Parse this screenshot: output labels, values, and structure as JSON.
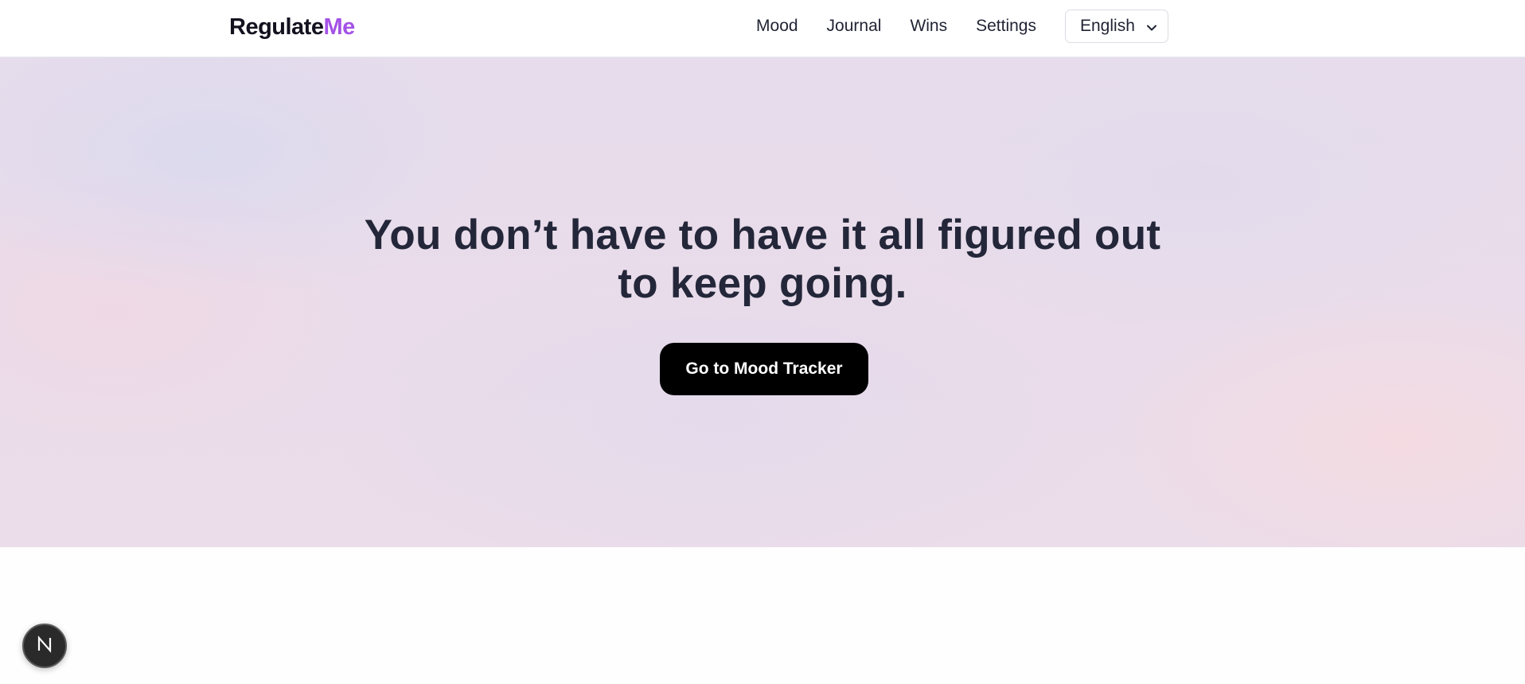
{
  "brand": {
    "name_main": "Regulate",
    "name_accent": "Me",
    "accent_color": "#a452e6"
  },
  "nav": {
    "links": [
      "Mood",
      "Journal",
      "Wins",
      "Settings"
    ],
    "language": {
      "selected": "English",
      "icon": "chevron-down-icon"
    }
  },
  "hero": {
    "headline_line1": "You don’t have to have it all figured out",
    "headline_line2": "to keep going.",
    "cta_label": "Go to Mood Tracker",
    "cta_color": "#000000"
  },
  "dev_badge": {
    "icon": "nextjs-logo-icon",
    "letter": "N"
  }
}
